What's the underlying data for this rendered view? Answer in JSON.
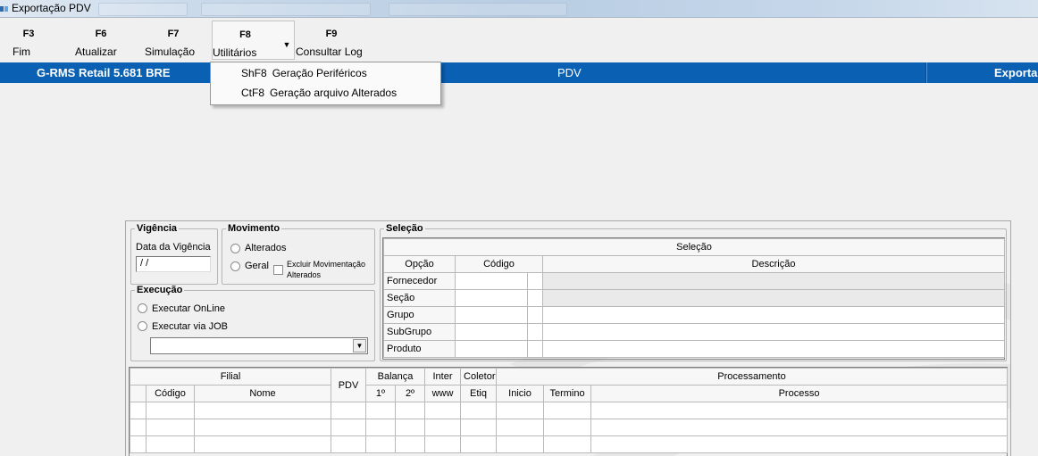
{
  "window": {
    "title": "Exportação PDV"
  },
  "toolbar": {
    "buttons": [
      {
        "key": "F3",
        "label": "Fim"
      },
      {
        "key": "F6",
        "label": "Atualizar"
      },
      {
        "key": "F7",
        "label": "Simulação"
      },
      {
        "key": "F8",
        "label": "Utilitários"
      },
      {
        "key": "F9",
        "label": "Consultar Log"
      }
    ]
  },
  "banner": {
    "system": "G-RMS Retail 5.681 BRE",
    "module": "PDV",
    "screen": "Exporta"
  },
  "menu": {
    "items": [
      {
        "key": "ShF8",
        "label": "Geração Periféricos"
      },
      {
        "key": "CtF8",
        "label": "Geração arquivo Alterados"
      }
    ]
  },
  "vigencia": {
    "title": "Vigência",
    "date_label": "Data da Vigência",
    "date_value": " / /"
  },
  "movimento": {
    "title": "Movimento",
    "alterados": "Alterados",
    "geral": "Geral",
    "excluir_line1": "Excluir Movimentação",
    "excluir_line2": "Alterados"
  },
  "execucao": {
    "title": "Execução",
    "online": "Executar OnLine",
    "job": "Executar via JOB",
    "job_value": ""
  },
  "selecao": {
    "title": "Seleção",
    "table_title": "Seleção",
    "headers": [
      "Opção",
      "Código",
      "Descrição"
    ],
    "rows": [
      "Fornecedor",
      "Seção",
      "Grupo",
      "SubGrupo",
      "Produto"
    ]
  },
  "processing": {
    "top": {
      "filial": "Filial",
      "pdv": "PDV",
      "balanca": "Balança",
      "inter": "Inter",
      "coletor": "Coletor",
      "processamento": "Processamento"
    },
    "sub": {
      "codigo": "Código",
      "nome": "Nome",
      "b1": "1º",
      "b2": "2º",
      "www": "www",
      "etiq": "Etiq",
      "inicio": "Inicio",
      "termino": "Termino",
      "processo": "Processo"
    }
  },
  "colors": {
    "banner": "#0a61b4",
    "background": "#f0f0f0"
  }
}
